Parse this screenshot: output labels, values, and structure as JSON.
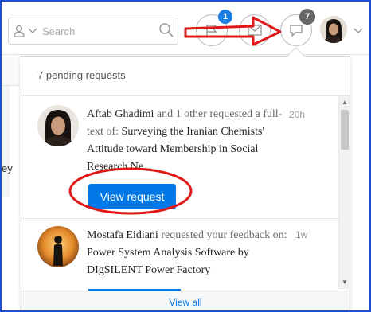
{
  "search": {
    "placeholder": "Search"
  },
  "header": {
    "notifications_badge": "1",
    "requests_badge": "7"
  },
  "left_partial_text": "ey",
  "dropdown": {
    "title": "7 pending requests",
    "requests": [
      {
        "name": "Aftab Ghadimi",
        "action": " and 1 other requested a full-text of: ",
        "paper": "Surveying the Iranian Chemists' Attitude toward Membership in Social Research Ne...",
        "time": "20h",
        "button": "View request"
      },
      {
        "name": "Mostafa Eidiani",
        "action": " requested your feedback on: ",
        "paper": "Power System Analysis Software by DIgSILENT Power Factory",
        "time": "1w"
      }
    ],
    "footer_link": "View all"
  },
  "colors": {
    "accent": "#0078e6",
    "annotation_red": "#e01818",
    "badge_blue": "#1a7de0",
    "badge_gray": "#666666"
  }
}
